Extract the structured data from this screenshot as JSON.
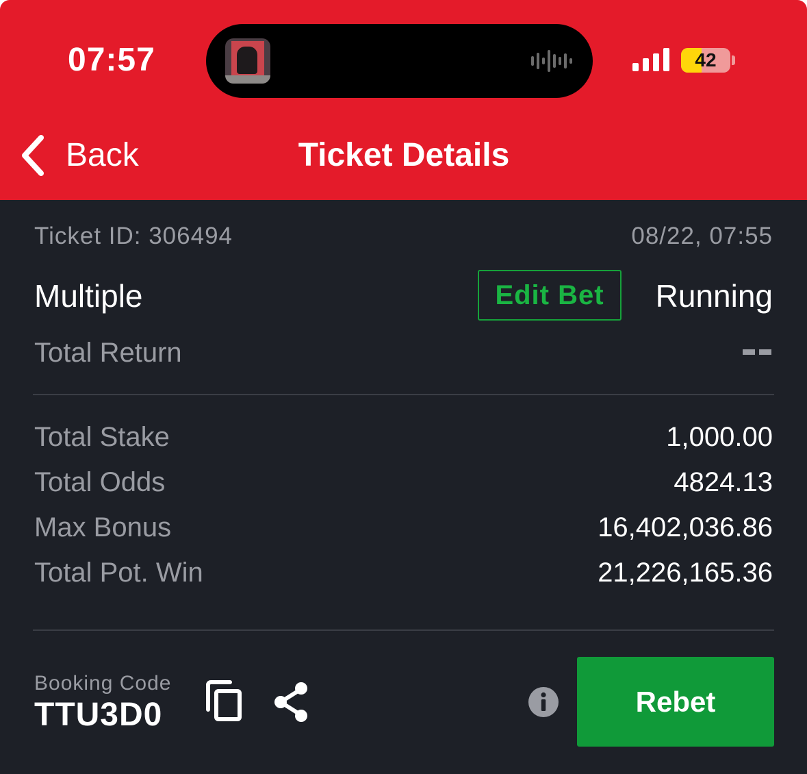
{
  "status_bar": {
    "time": "07:57",
    "battery_level": "42",
    "battery_fraction": 0.42,
    "icons": [
      "album-art-thumbnail",
      "audio-waveform-icon",
      "cellular-signal-icon",
      "battery-icon"
    ]
  },
  "nav": {
    "back_label": "Back",
    "title": "Ticket Details",
    "icons": [
      "chevron-left-icon"
    ]
  },
  "ticket": {
    "id_text": "Ticket ID: 306494",
    "datetime": "08/22, 07:55",
    "bet_type": "Multiple",
    "edit_bet_label": "Edit Bet",
    "status": "Running",
    "total_return_label": "Total Return",
    "total_return_value": "--"
  },
  "summary": [
    {
      "label": "Total Stake",
      "value": "1,000.00"
    },
    {
      "label": "Total Odds",
      "value": "4824.13"
    },
    {
      "label": "Max Bonus",
      "value": "16,402,036.86"
    },
    {
      "label": "Total Pot. Win",
      "value": "21,226,165.36"
    }
  ],
  "booking": {
    "label": "Booking Code",
    "code": "TTU3D0",
    "icons": [
      "copy-icon",
      "share-icon",
      "info-icon"
    ],
    "rebet_label": "Rebet"
  },
  "colors": {
    "header_red": "#e41b2a",
    "background_dark": "#1d2027",
    "accent_green": "#109a39",
    "muted_text": "#9a9ca3",
    "battery_yellow": "#ffd60a"
  }
}
